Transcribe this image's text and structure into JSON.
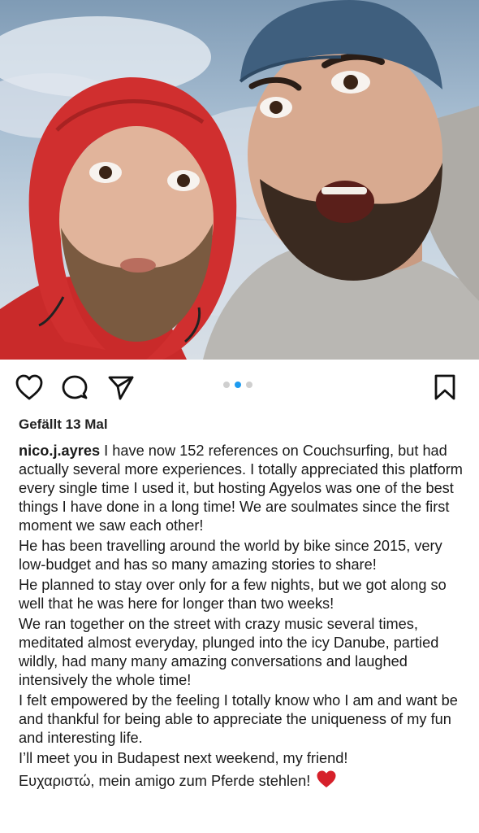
{
  "post": {
    "likes_text": "Gefällt 13 Mal",
    "carousel": {
      "count": 3,
      "active_index": 1
    },
    "username": "nico.j.ayres",
    "caption_paragraphs": [
      "I have now 152 references on Couchsurfing, but had actually several more experiences. I totally appreciated this platform every single time I used it, but hosting Agyelos was one of the best things I have done in a long time! We are soulmates since the first moment we saw each other!",
      "He has been travelling around the world by bike since 2015, very low-budget and has so many amazing stories to share!",
      "He planned to stay over only for a few nights, but we got along so well that he was here for longer than two weeks!",
      "We ran together on the street with crazy music several times, meditated almost everyday, plunged into the icy Danube, partied wildly, had many many amazing conversations and laughed intensively the whole time!",
      "I felt empowered by the feeling I totally know who I am and want be and thankful for being able to appreciate the uniqueness of my fun and interesting life.",
      "I’ll meet you in Budapest next weekend, my friend!"
    ],
    "last_line": "Ευχαριστώ, mein amigo zum Pferde stehlen!",
    "last_emoji": "heart-emoji"
  },
  "icons": {
    "like": "heart-outline-icon",
    "comment": "comment-bubble-icon",
    "share": "paper-plane-icon",
    "save": "bookmark-icon"
  },
  "colors": {
    "carousel_active": "#1d9bf0",
    "carousel_inactive": "#cfcfcf",
    "emoji_heart": "#d6202a"
  }
}
